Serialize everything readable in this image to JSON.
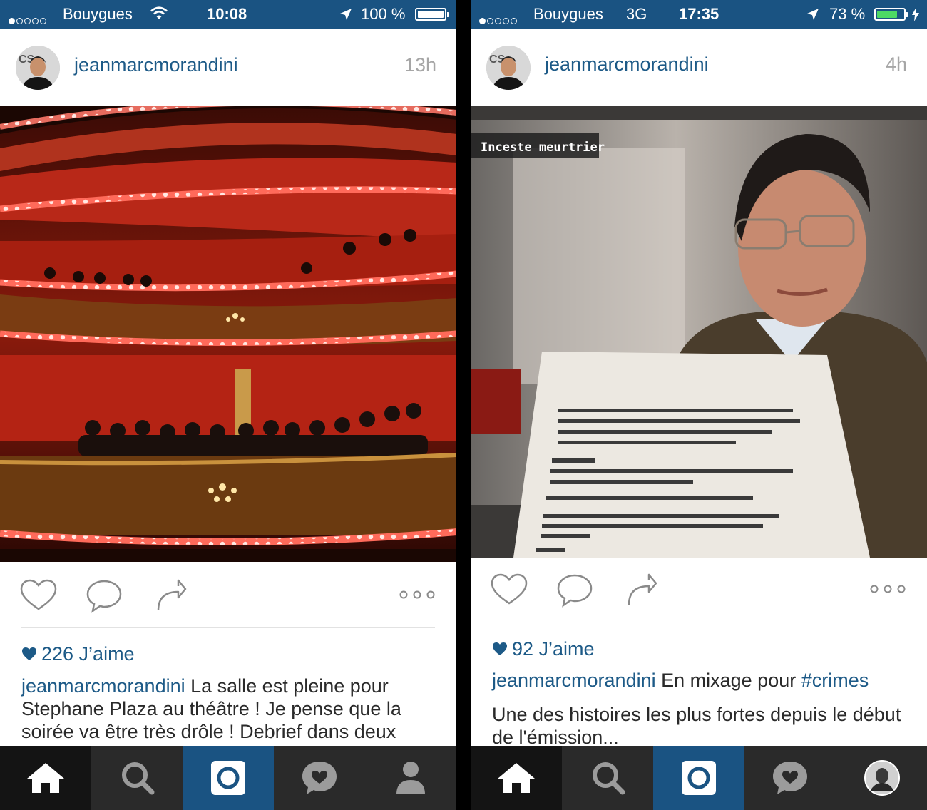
{
  "screens": [
    {
      "status": {
        "carrier": "Bouygues",
        "network": "",
        "time": "10:08",
        "battery": "100 %",
        "battery_level": 1.0,
        "charging": false,
        "wifi": true
      },
      "post": {
        "username": "jeanmarcmorandini",
        "time_ago": "13h",
        "photo": "theatre-balconies-photo",
        "likes": "226 J’aime",
        "caption_user": "jeanmarcmorandini",
        "caption_text": " La salle est pleine pour Stephane Plaza au théâtre ! Je pense que la soirée va être très drôle ! Debrief dans deux"
      },
      "tabbar": [
        "home-tab",
        "search-tab",
        "camera-tab",
        "activity-tab",
        "profile-tab"
      ]
    },
    {
      "status": {
        "carrier": "Bouygues",
        "network": "3G",
        "time": "17:35",
        "battery": "73 %",
        "battery_level": 0.73,
        "charging": true,
        "wifi": false
      },
      "post": {
        "username": "jeanmarcmorandini",
        "time_ago": "4h",
        "photo": "tv-screen-photo",
        "photo_overlay": "Inceste meurtrier",
        "likes": "92 J’aime",
        "caption_user": "jeanmarcmorandini",
        "caption_text": " En mixage pour ",
        "caption_tag": "#crimes",
        "caption_line2": "Une des histoires les plus fortes depuis le début de l'émission..."
      },
      "tabbar": [
        "home-tab",
        "search-tab",
        "camera-tab",
        "activity-tab",
        "profile-avatar-tab"
      ]
    }
  ],
  "colors": {
    "status_bar": "#1a5382",
    "link": "#1d5a87",
    "tab_bar": "#2a2a2a",
    "tab_active": "#141414",
    "battery_green": "#4cd964"
  }
}
